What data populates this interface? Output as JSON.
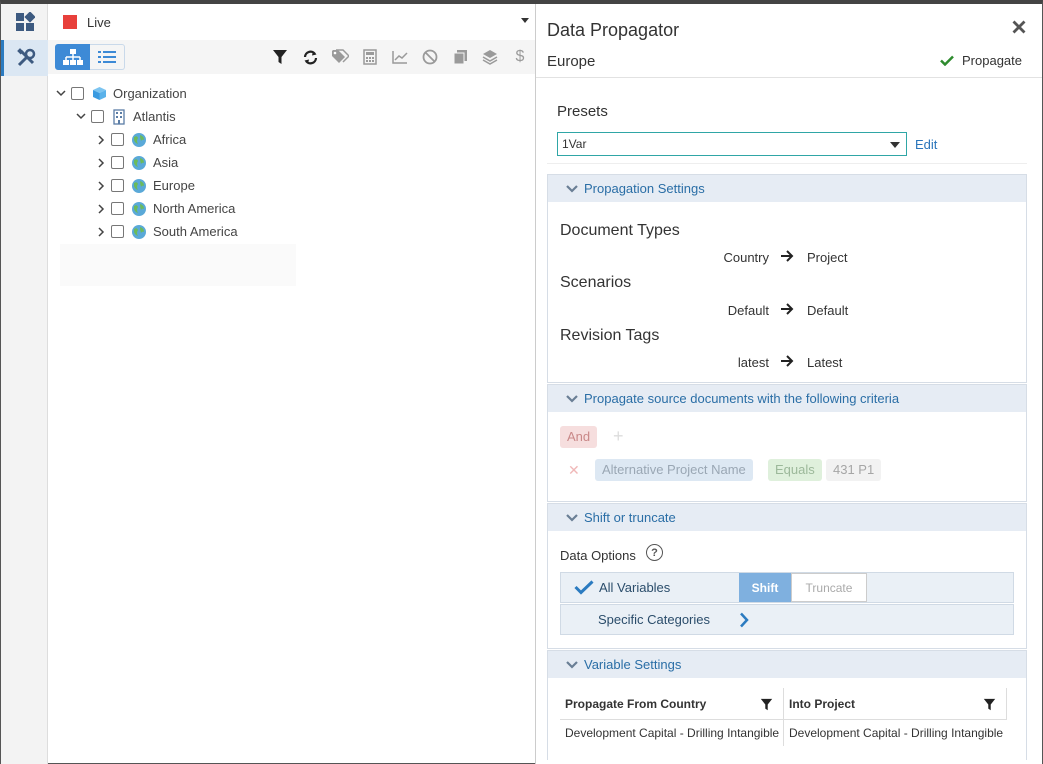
{
  "rail": {
    "items": [
      {
        "icon": "dashboard-icon"
      },
      {
        "icon": "tools-icon"
      }
    ]
  },
  "tree_panel": {
    "scenario": {
      "label": "Live",
      "color": "#e8403b"
    },
    "view_toggle": [
      {
        "icon": "hierarchy-icon",
        "selected": true
      },
      {
        "icon": "list-icon",
        "selected": false
      }
    ],
    "tools": [
      "filter-icon",
      "refresh-icon",
      "tag-icon",
      "calculator-icon",
      "chart-icon",
      "block-icon",
      "copy-icon",
      "layers-icon",
      "dollar-icon"
    ],
    "tree": [
      {
        "label": "Organization",
        "icon": "cube-icon",
        "expanded": true,
        "checked": false
      },
      {
        "label": "Atlantis",
        "icon": "building-icon",
        "expanded": true,
        "checked": false
      },
      {
        "label": "Africa",
        "icon": "globe-icon",
        "expanded": false,
        "checked": false
      },
      {
        "label": "Asia",
        "icon": "globe-icon",
        "expanded": false,
        "checked": false
      },
      {
        "label": "Europe",
        "icon": "globe-icon",
        "expanded": false,
        "checked": false
      },
      {
        "label": "North America",
        "icon": "globe-icon",
        "expanded": false,
        "checked": false
      },
      {
        "label": "South America",
        "icon": "globe-icon",
        "expanded": false,
        "checked": false
      }
    ]
  },
  "panel": {
    "title": "Data Propagator",
    "subtitle": "Europe",
    "propagate_label": "Propagate",
    "presets": {
      "label": "Presets",
      "value": "1Var",
      "edit_label": "Edit"
    },
    "propagation_settings": {
      "header": "Propagation Settings",
      "groups": [
        {
          "title": "Document Types",
          "from": "Country",
          "to": "Project"
        },
        {
          "title": "Scenarios",
          "from": "Default",
          "to": "Default"
        },
        {
          "title": "Revision Tags",
          "from": "latest",
          "to": "Latest"
        }
      ]
    },
    "criteria": {
      "header": "Propagate source documents with the following criteria",
      "operator": "And",
      "add_symbol": "+",
      "remove_symbol": "✕",
      "field": "Alternative Project Name",
      "comparison": "Equals",
      "value": "431 P1"
    },
    "shift": {
      "header": "Shift or truncate",
      "data_options_label": "Data Options",
      "help_symbol": "?",
      "all_variables_label": "All Variables",
      "shift_label": "Shift",
      "truncate_label": "Truncate",
      "specific_categories_label": "Specific Categories"
    },
    "variables": {
      "header": "Variable Settings",
      "columns": [
        "Propagate From Country",
        "Into Project"
      ],
      "rows": [
        [
          "Development Capital - Drilling Intangible",
          "Development Capital - Drilling Intangible"
        ]
      ]
    }
  }
}
